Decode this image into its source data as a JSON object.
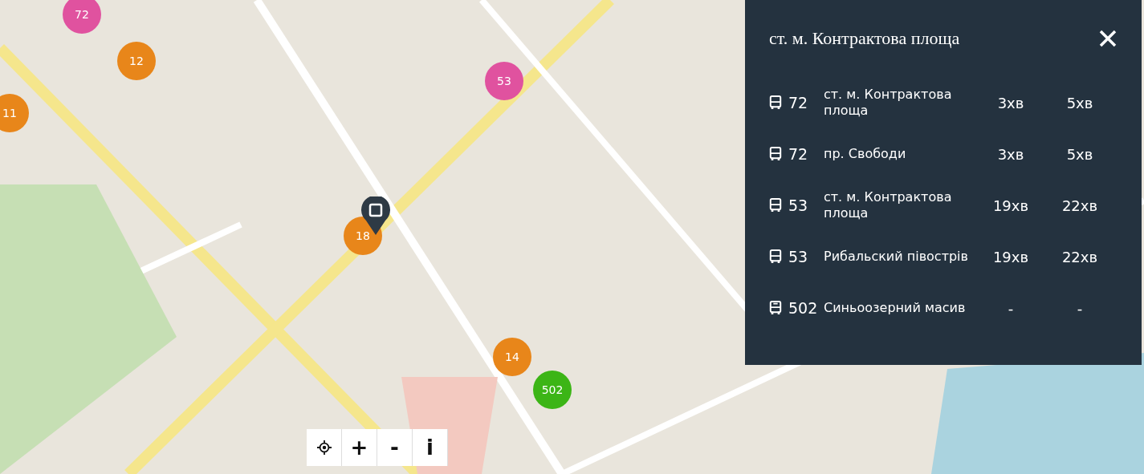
{
  "map": {
    "vehicles": [
      {
        "route": "72",
        "color": "#e0529f"
      },
      {
        "route": "12",
        "color": "#e8861a"
      },
      {
        "route": "11",
        "color": "#e8861a"
      },
      {
        "route": "53",
        "color": "#e0529f"
      },
      {
        "route": "18",
        "color": "#e8861a"
      },
      {
        "route": "14",
        "color": "#e8861a"
      },
      {
        "route": "502",
        "color": "#3cb516"
      }
    ]
  },
  "panel": {
    "title": "ст. м. Контрактова площа",
    "arrivals": [
      {
        "kind": "bus",
        "route": "72",
        "destination": "ст. м. Контрактова площа",
        "next": "3хв",
        "after": "5хв"
      },
      {
        "kind": "bus",
        "route": "72",
        "destination": "пр. Свободи",
        "next": "3хв",
        "after": "5хв"
      },
      {
        "kind": "bus",
        "route": "53",
        "destination": "ст. м. Контрактова площа",
        "next": "19хв",
        "after": "22хв"
      },
      {
        "kind": "bus",
        "route": "53",
        "destination": "Рибальский півострів",
        "next": "19хв",
        "after": "22хв"
      },
      {
        "kind": "trolleybus",
        "route": "502",
        "destination": "Синьоозерний масив",
        "next": "-",
        "after": "-"
      }
    ]
  },
  "controls": [
    "+",
    "-",
    "i"
  ]
}
